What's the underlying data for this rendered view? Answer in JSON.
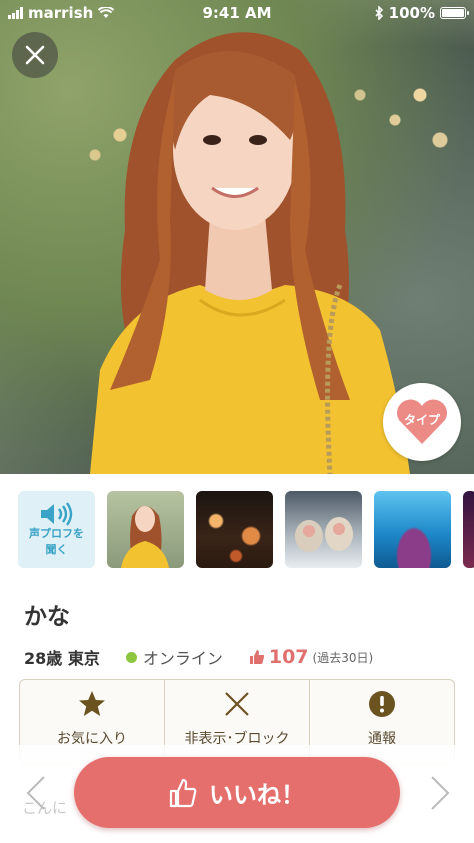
{
  "status_bar": {
    "carrier": "marrish",
    "time": "9:41 AM",
    "battery": "100%"
  },
  "profile": {
    "type_label": "タイプ",
    "voice_label": "声プロフを聞く",
    "name": "かな",
    "age_location": "28歳 東京",
    "online_status": "オンライン",
    "likes_count": "107",
    "likes_period": "(過去30日)"
  },
  "actions": {
    "favorite": "お気に入り",
    "hide_block": "非表示･ブロック",
    "report": "通報"
  },
  "bottom": {
    "like_label": "いいね！",
    "message_preview": "こんに"
  },
  "colors": {
    "accent": "#e46f6c",
    "online": "#8dc63f",
    "voice": "#3aa3c6"
  },
  "icons": [
    "signal-icon",
    "wifi-icon",
    "bluetooth-icon",
    "battery-icon",
    "close-icon",
    "heart-icon",
    "speaker-icon",
    "star-icon",
    "x-icon",
    "exclamation-icon",
    "thumbs-up-icon",
    "chevron-left-icon",
    "chevron-right-icon"
  ]
}
